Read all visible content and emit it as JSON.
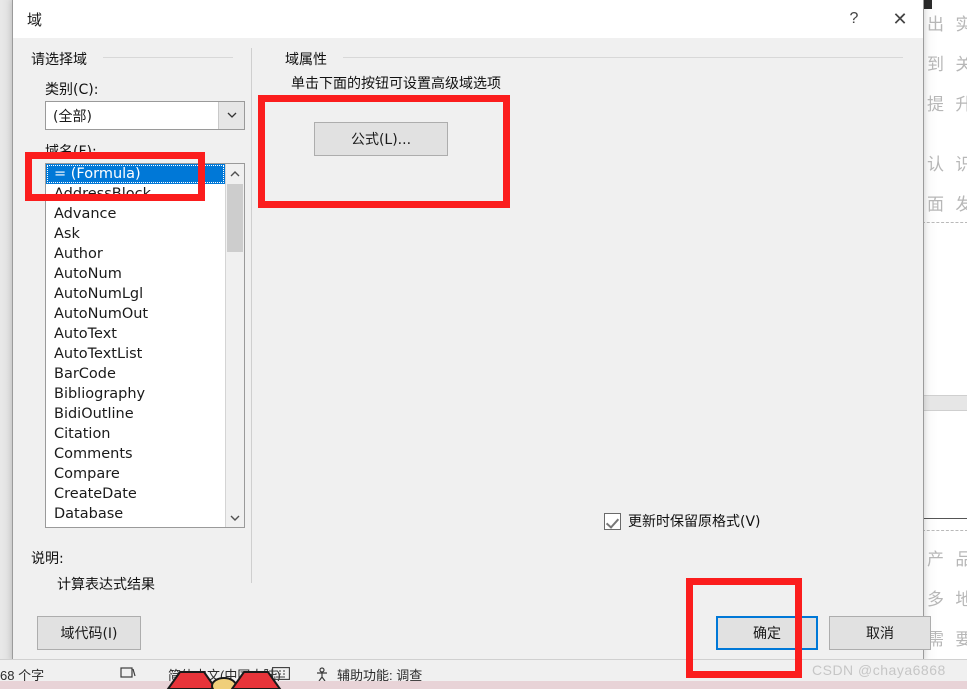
{
  "dialog": {
    "title": "域",
    "help_icon": "?",
    "close_icon": "✕",
    "left_group": {
      "header": "请选择域",
      "category_label": "类别(C):",
      "category_value": "(全部)",
      "fieldname_label": "域名(F):",
      "dropdown_icon": "chevron-down-icon",
      "fields": [
        "= (Formula)",
        "AddressBlock",
        "Advance",
        "Ask",
        "Author",
        "AutoNum",
        "AutoNumLgl",
        "AutoNumOut",
        "AutoText",
        "AutoTextList",
        "BarCode",
        "Bibliography",
        "BidiOutline",
        "Citation",
        "Comments",
        "Compare",
        "CreateDate",
        "Database"
      ],
      "selected_field": "= (Formula)",
      "scroll_up_icon": "chevron-up-icon",
      "scroll_down_icon": "chevron-down-icon",
      "description_label": "说明:",
      "description_text": "计算表达式结果",
      "fieldcode_button": "域代码(I)"
    },
    "right_group": {
      "header": "域属性",
      "hint": "单击下面的按钮可设置高级域选项",
      "formula_button": "公式(L)...",
      "preserve_format_label": "更新时保留原格式(V)",
      "preserve_format_checked": true
    },
    "footer": {
      "ok_button": "确定",
      "cancel_button": "取消"
    },
    "accent_focus_color": "#0078d7",
    "annotation_color": "#fb1d1d"
  },
  "statusbar": {
    "word_count": "68 个字",
    "proofing_icon": "proofing-errors-icon",
    "language": "简体中文(中国大陆)",
    "keyboard_icon": "keyboard-icon",
    "accessibility_icon": "accessibility-icon",
    "accessibility_text": "辅助功能: 调查"
  },
  "watermark": "CSDN @chaya6868",
  "background_document": {
    "lines": [
      "出 实",
      "到 关",
      "提 升",
      "认 识",
      "面 发",
      "产 品",
      "多 地",
      "需 要"
    ]
  }
}
